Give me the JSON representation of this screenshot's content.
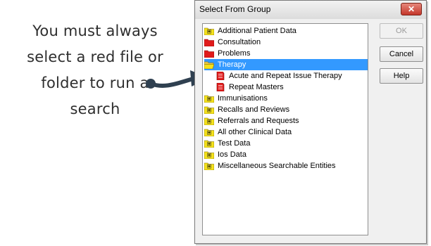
{
  "callout": {
    "lines": [
      "You must always",
      "select a red file or",
      "folder to run a",
      "search"
    ]
  },
  "dialog": {
    "title": "Select From Group",
    "close_symbol": "✕",
    "buttons": {
      "ok": "OK",
      "cancel": "Cancel",
      "help": "Help"
    },
    "tree": [
      {
        "label": "Additional Patient Data",
        "icon": "yellow-folder-plus-icon"
      },
      {
        "label": "Consultation",
        "icon": "red-folder-icon"
      },
      {
        "label": "Problems",
        "icon": "red-folder-icon"
      },
      {
        "label": "Therapy",
        "icon": "open-folder-icon",
        "selected": true
      },
      {
        "label": "Acute and Repeat Issue Therapy",
        "icon": "red-file-icon",
        "child": true
      },
      {
        "label": "Repeat Masters",
        "icon": "red-file-icon",
        "child": true
      },
      {
        "label": "Immunisations",
        "icon": "yellow-folder-plus-icon"
      },
      {
        "label": "Recalls and Reviews",
        "icon": "yellow-folder-plus-icon"
      },
      {
        "label": "Referrals and Requests",
        "icon": "yellow-folder-plus-icon"
      },
      {
        "label": "All other Clinical Data",
        "icon": "yellow-folder-plus-icon"
      },
      {
        "label": "Test Data",
        "icon": "yellow-folder-plus-icon"
      },
      {
        "label": "Ios Data",
        "icon": "yellow-folder-plus-icon"
      },
      {
        "label": "Miscellaneous Searchable Entities",
        "icon": "yellow-folder-plus-icon"
      }
    ]
  },
  "colors": {
    "selection": "#3399ff",
    "red_folder": "#e01b1b",
    "yellow_folder": "#f5e21a",
    "close_button": "#c4372a"
  }
}
